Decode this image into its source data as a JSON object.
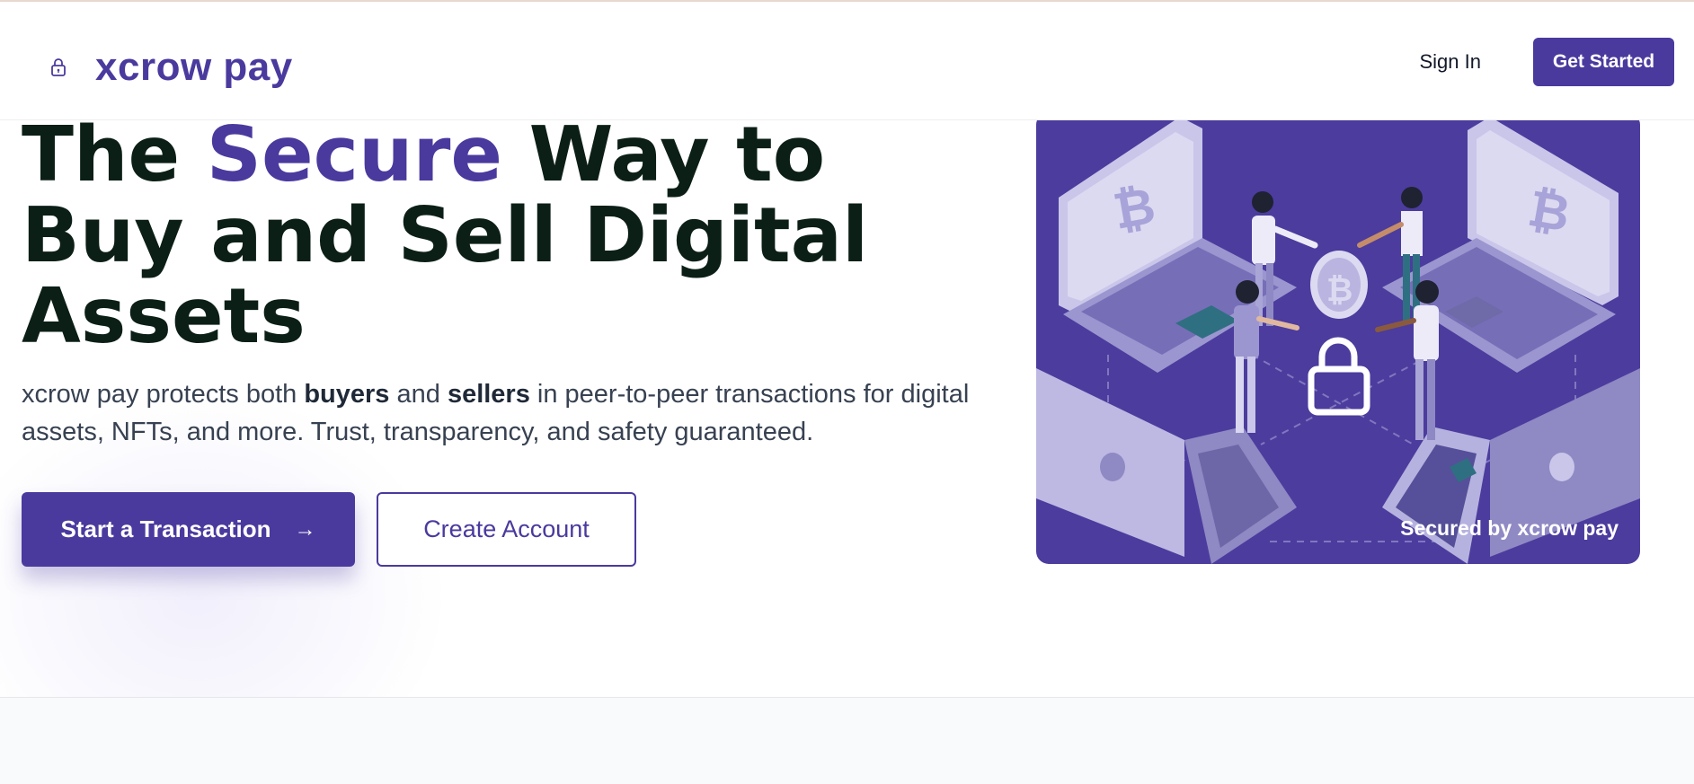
{
  "header": {
    "brand_name": "xcrow pay",
    "brand_icon": "lock-icon",
    "sign_in_label": "Sign In",
    "get_started_label": "Get Started"
  },
  "hero": {
    "title_part1": "The ",
    "title_accent": "Secure",
    "title_part2": " Way to Buy and Sell Digital Assets",
    "description": {
      "part1": "xcrow pay protects both ",
      "buyers": "buyers",
      "part2": " and ",
      "sellers": "sellers",
      "part3": " in peer-to-peer transactions for digital assets, NFTs, and more. Trust, transparency, and safety guaranteed."
    },
    "primary_cta": "Start a Transaction",
    "primary_cta_icon": "arrow-right-icon",
    "secondary_cta": "Create Account"
  },
  "illustration": {
    "caption": "Secured by xcrow pay",
    "icons": [
      "laptop-icon",
      "bitcoin-icon",
      "people-icon",
      "padlock-icon"
    ]
  },
  "colors": {
    "brand": "#4a3a9e",
    "heading": "#0b1f16",
    "body_text": "#374151",
    "card_bg": "#4b3c9e"
  }
}
